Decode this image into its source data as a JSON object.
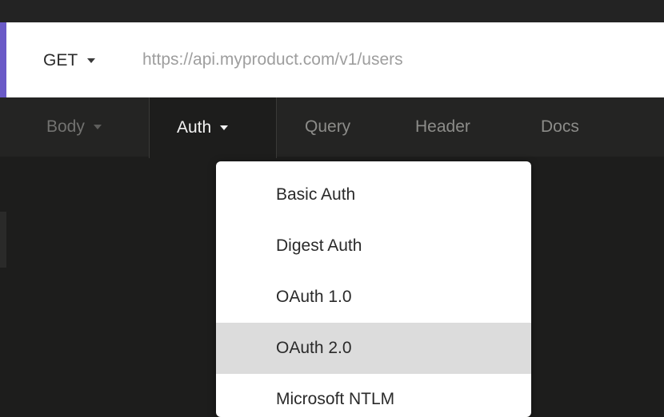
{
  "request": {
    "method": "GET",
    "url_placeholder": "https://api.myproduct.com/v1/users"
  },
  "tabs": [
    {
      "label": "Body",
      "has_caret": true,
      "active": false
    },
    {
      "label": "Auth",
      "has_caret": true,
      "active": true
    },
    {
      "label": "Query",
      "has_caret": false,
      "active": false
    },
    {
      "label": "Header",
      "has_caret": false,
      "active": false
    },
    {
      "label": "Docs",
      "has_caret": false,
      "active": false
    }
  ],
  "auth_menu": {
    "items": [
      {
        "label": "Basic Auth"
      },
      {
        "label": "Digest Auth"
      },
      {
        "label": "OAuth 1.0"
      },
      {
        "label": "OAuth 2.0",
        "highlighted": true
      },
      {
        "label": "Microsoft NTLM"
      }
    ]
  },
  "colors": {
    "accent": "#6a5ac7",
    "background": "#1d1d1c",
    "tabbar": "#242423",
    "highlight": "#dcdcdc"
  }
}
